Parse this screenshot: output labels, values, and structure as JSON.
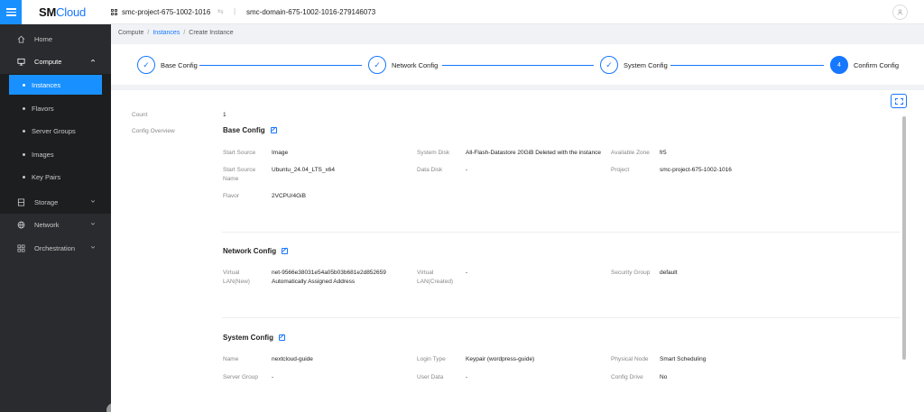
{
  "topbar": {
    "logo_sm": "SM",
    "logo_cloud": "Cloud",
    "project": "smc-project-675-1002-1016",
    "swap_symbol": "⇆",
    "separator": "|",
    "domain": "smc-domain-675-1002-1016-279146073"
  },
  "sidebar": {
    "items": [
      {
        "label": "Home",
        "icon": "home-icon"
      },
      {
        "label": "Compute",
        "icon": "monitor-icon"
      },
      {
        "label": "Storage",
        "icon": "storage-icon"
      },
      {
        "label": "Network",
        "icon": "globe-icon"
      },
      {
        "label": "Orchestration",
        "icon": "grid-icon"
      }
    ],
    "compute_sub": [
      "Instances",
      "Flavors",
      "Server Groups",
      "Images",
      "Key Pairs"
    ],
    "active_sub": "Instances"
  },
  "breadcrumb": {
    "b1": "Compute",
    "b2": "Instances",
    "b3": "Create Instance"
  },
  "steps": [
    {
      "label": "Base Config",
      "state": "done"
    },
    {
      "label": "Network Config",
      "state": "done"
    },
    {
      "label": "System Config",
      "state": "done"
    },
    {
      "label": "Confirm Config",
      "state": "active",
      "number": "4"
    }
  ],
  "summary": {
    "count_label": "Count",
    "count_value": "1",
    "overview_label": "Config Overview"
  },
  "base_config": {
    "title": "Base Config",
    "start_source_label": "Start Source",
    "start_source_value": "Image",
    "system_disk_label": "System Disk",
    "system_disk_value": "All-Flash-Datastore 20GiB Deleted with the instance",
    "zone_label": "Available Zone",
    "zone_value": "fr5",
    "source_name_label_1": "Start Source",
    "source_name_label_2": "Name",
    "source_name_value": "Ubuntu_24.04_LTS_x64",
    "data_disk_label": "Data Disk",
    "data_disk_value": "-",
    "project_label": "Project",
    "project_value": "smc-project-675-1002-1016",
    "flavor_label": "Flavor",
    "flavor_value": "2VCPU/4GiB"
  },
  "network_config": {
    "title": "Network Config",
    "vlan_new_label_1": "Virtual",
    "vlan_new_label_2": "LAN(New)",
    "vlan_new_value_1": "net-9566e38031e54a05b03b681e2d852659",
    "vlan_new_value_2": "Automatically Assigned Address",
    "vlan_created_label_1": "Virtual",
    "vlan_created_label_2": "LAN(Created)",
    "vlan_created_value": "-",
    "security_group_label": "Security Group",
    "security_group_value": "default"
  },
  "system_config": {
    "title": "System Config",
    "name_label": "Name",
    "name_value": "nextcloud-guide",
    "login_type_label": "Login Type",
    "login_type_value": "Keypair (wordpress-guide)",
    "physical_node_label": "Physical Node",
    "physical_node_value": "Smart Scheduling",
    "server_group_label": "Server Group",
    "server_group_value": "-",
    "user_data_label": "User Data",
    "user_data_value": "-",
    "config_drive_label": "Config Drive",
    "config_drive_value": "No"
  }
}
